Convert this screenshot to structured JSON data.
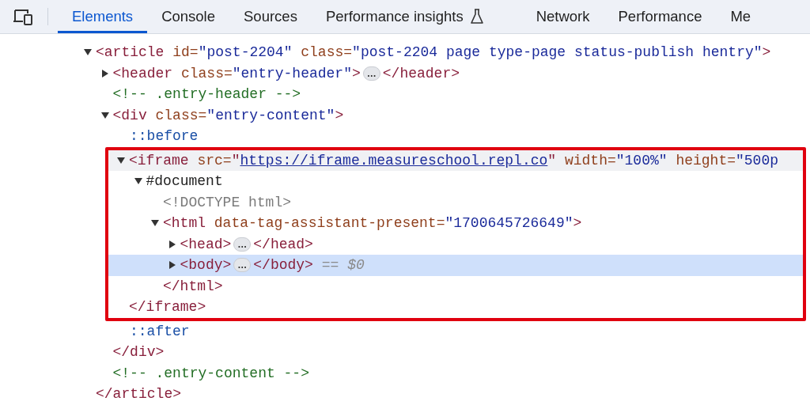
{
  "tabs": [
    {
      "label": "Elements",
      "selected": true,
      "kind": "text"
    },
    {
      "label": "Console",
      "selected": false,
      "kind": "text"
    },
    {
      "label": "Sources",
      "selected": false,
      "kind": "text"
    },
    {
      "label": "Performance insights",
      "selected": false,
      "kind": "experimental"
    },
    {
      "label": "Network",
      "selected": false,
      "kind": "text"
    },
    {
      "label": "Performance",
      "selected": false,
      "kind": "text"
    },
    {
      "label": "Me",
      "selected": false,
      "kind": "text"
    }
  ],
  "dom_tree": [
    {
      "expanded": true,
      "selected": false,
      "hovered": false,
      "tokens": [
        {
          "kind": "tag",
          "text": "<article"
        },
        {
          "kind": "attr",
          "text": " id="
        },
        {
          "kind": "value",
          "text": "\"post-2204\""
        },
        {
          "kind": "attr",
          "text": " class="
        },
        {
          "kind": "value",
          "text": "\"post-2204 page type-page status-publish hentry\""
        },
        {
          "kind": "tag",
          "text": ">"
        }
      ],
      "children": [
        {
          "expanded": false,
          "selected": false,
          "hovered": false,
          "tokens": [
            {
              "kind": "tag",
              "text": "<header"
            },
            {
              "kind": "attr",
              "text": " class="
            },
            {
              "kind": "value",
              "text": "\"entry-header\""
            },
            {
              "kind": "tag",
              "text": ">"
            },
            {
              "kind": "ellipsis",
              "text": "…"
            },
            {
              "kind": "tag",
              "text": "</header>"
            }
          ]
        },
        {
          "selected": false,
          "hovered": false,
          "tokens": [
            {
              "kind": "comment",
              "text": "<!-- .entry-header -->"
            }
          ]
        },
        {
          "expanded": true,
          "selected": false,
          "hovered": false,
          "tokens": [
            {
              "kind": "tag",
              "text": "<div"
            },
            {
              "kind": "attr",
              "text": " class="
            },
            {
              "kind": "value",
              "text": "\"entry-content\""
            },
            {
              "kind": "tag",
              "text": ">"
            }
          ],
          "children": [
            {
              "selected": false,
              "hovered": false,
              "tokens": [
                {
                  "kind": "pseudo",
                  "text": "::before"
                }
              ]
            },
            {
              "expanded": true,
              "selected": false,
              "hovered": true,
              "outlined": true,
              "tokens": [
                {
                  "kind": "tag",
                  "text": "<iframe"
                },
                {
                  "kind": "attr",
                  "text": " src="
                },
                {
                  "kind": "tag",
                  "text": "\""
                },
                {
                  "kind": "link",
                  "text": "https://iframe.measureschool.repl.co"
                },
                {
                  "kind": "tag",
                  "text": "\""
                },
                {
                  "kind": "attr",
                  "text": " width="
                },
                {
                  "kind": "value",
                  "text": "\"100%\""
                },
                {
                  "kind": "attr",
                  "text": " height="
                },
                {
                  "kind": "value",
                  "text": "\"500p"
                }
              ],
              "children": [
                {
                  "expanded": true,
                  "selected": false,
                  "hovered": false,
                  "tokens": [
                    {
                      "kind": "plain",
                      "text": "#document"
                    }
                  ],
                  "children": [
                    {
                      "selected": false,
                      "hovered": false,
                      "tokens": [
                        {
                          "kind": "doctype",
                          "text": "<!DOCTYPE html>"
                        }
                      ]
                    },
                    {
                      "expanded": true,
                      "selected": false,
                      "hovered": false,
                      "tokens": [
                        {
                          "kind": "tag",
                          "text": "<html"
                        },
                        {
                          "kind": "attr",
                          "text": " data-tag-assistant-present="
                        },
                        {
                          "kind": "value",
                          "text": "\"1700645726649\""
                        },
                        {
                          "kind": "tag",
                          "text": ">"
                        }
                      ],
                      "children": [
                        {
                          "expanded": false,
                          "selected": false,
                          "hovered": false,
                          "tokens": [
                            {
                              "kind": "tag",
                              "text": "<head>"
                            },
                            {
                              "kind": "ellipsis",
                              "text": "…"
                            },
                            {
                              "kind": "tag",
                              "text": "</head>"
                            }
                          ]
                        },
                        {
                          "expanded": false,
                          "selected": true,
                          "hovered": false,
                          "tokens": [
                            {
                              "kind": "tag",
                              "text": "<body>"
                            },
                            {
                              "kind": "ellipsis",
                              "text": "…"
                            },
                            {
                              "kind": "tag",
                              "text": "</body>"
                            },
                            {
                              "kind": "muted",
                              "text": " == "
                            },
                            {
                              "kind": "var",
                              "text": "$0"
                            }
                          ]
                        }
                      ],
                      "closing": [
                        {
                          "kind": "tag",
                          "text": "</html>"
                        }
                      ]
                    }
                  ]
                }
              ],
              "closing": [
                {
                  "kind": "tag",
                  "text": "</iframe>"
                }
              ]
            },
            {
              "selected": false,
              "hovered": false,
              "tokens": [
                {
                  "kind": "pseudo",
                  "text": "::after"
                }
              ]
            }
          ],
          "closing": [
            {
              "kind": "tag",
              "text": "</div>"
            }
          ]
        },
        {
          "selected": false,
          "hovered": false,
          "tokens": [
            {
              "kind": "comment",
              "text": "<!-- .entry-content -->"
            }
          ]
        }
      ],
      "closing": [
        {
          "kind": "tag",
          "text": "</article>"
        }
      ]
    }
  ]
}
